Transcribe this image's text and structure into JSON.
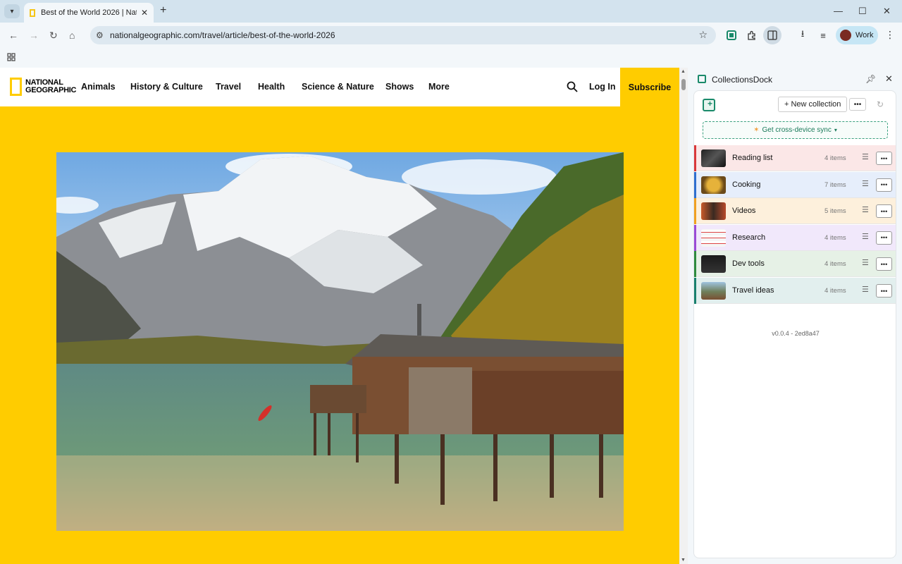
{
  "tab": {
    "title": "Best of the World 2026 | Nation",
    "close_label": "✕"
  },
  "toolbar": {
    "url": "nationalgeographic.com/travel/article/best-of-the-world-2026"
  },
  "profile": {
    "label": "Work"
  },
  "site": {
    "logo_line1": "NATIONAL",
    "logo_line2": "GEOGRAPHIC",
    "nav": [
      "Animals",
      "History & Culture",
      "Travel",
      "Health",
      "Science & Nature",
      "Shows",
      "More"
    ],
    "login": "Log In",
    "subscribe": "Subscribe"
  },
  "panel": {
    "title": "CollectionsDock",
    "new_collection": "+ New collection",
    "sync": "Get cross-device sync",
    "version": "v0.0.4 - 2ed8a47",
    "collections": [
      {
        "name": "Reading list",
        "count": "4 items",
        "color": "#d9383a",
        "bg": "#fbe7e7"
      },
      {
        "name": "Cooking",
        "count": "7 items",
        "color": "#2f6fcf",
        "bg": "#e6eefb"
      },
      {
        "name": "Videos",
        "count": "5 items",
        "color": "#f0a020",
        "bg": "#fdf0dc"
      },
      {
        "name": "Research",
        "count": "4 items",
        "color": "#9a4bd6",
        "bg": "#f1e8fb"
      },
      {
        "name": "Dev tools",
        "count": "4 items",
        "color": "#2e8b3e",
        "bg": "#e6f1e6"
      },
      {
        "name": "Travel ideas",
        "count": "4 items",
        "color": "#19806e",
        "bg": "#e2efee"
      }
    ]
  }
}
